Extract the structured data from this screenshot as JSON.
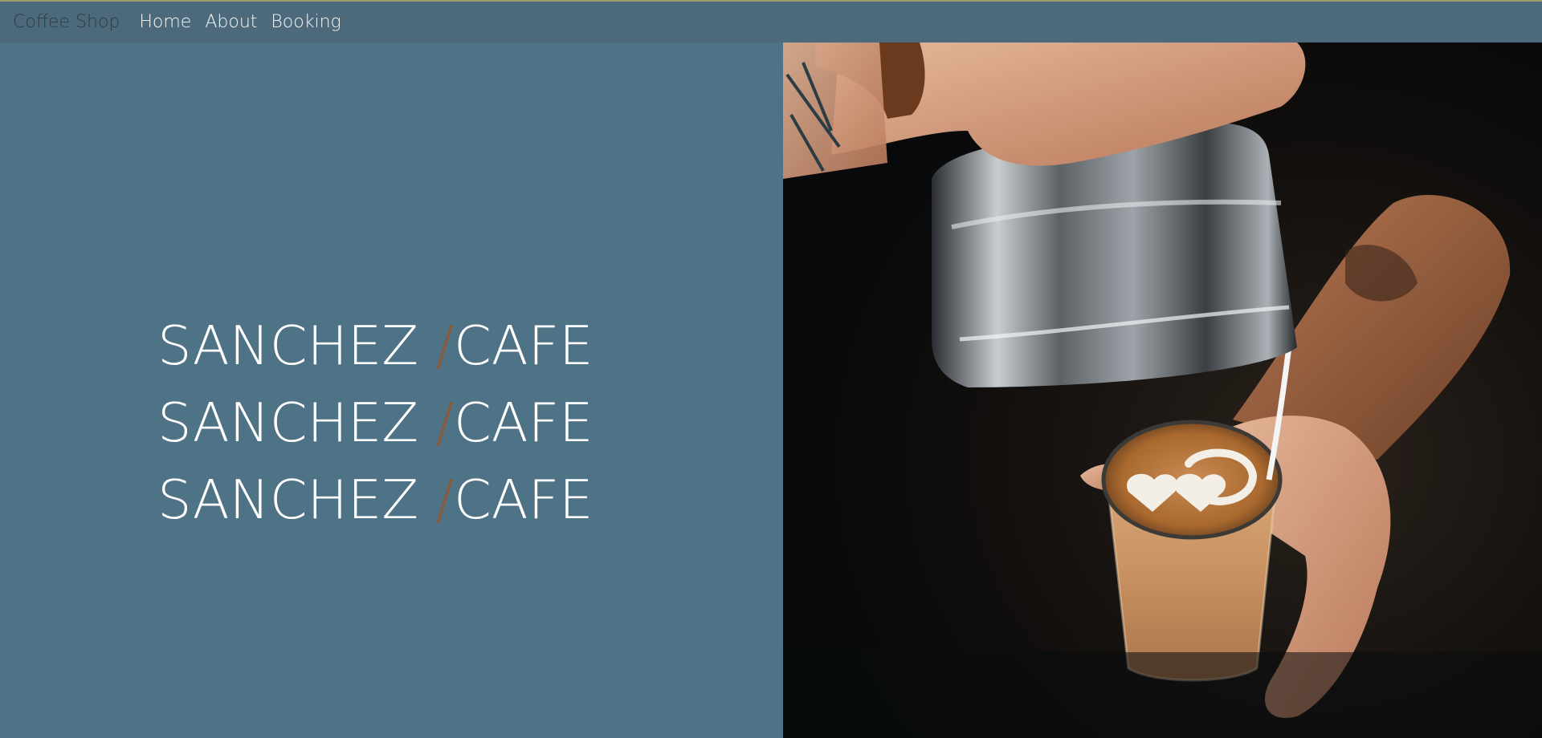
{
  "navbar": {
    "brand": "Coffee Shop",
    "links": [
      {
        "label": "Home"
      },
      {
        "label": "About"
      },
      {
        "label": "Booking"
      }
    ]
  },
  "hero": {
    "lines": [
      {
        "first": "SANCHEZ ",
        "slash": "/",
        "second": "CAFE"
      },
      {
        "first": "SANCHEZ ",
        "slash": "/",
        "second": "CAFE"
      },
      {
        "first": "SANCHEZ ",
        "slash": "/",
        "second": "CAFE"
      }
    ],
    "photo_subject": "barista-pouring-latte-art"
  },
  "colors": {
    "navbar_bg": "#4c6a7b",
    "hero_bg": "#4f7386",
    "slash_accent": "#8a5a3a",
    "brand_text": "#2c3c45",
    "nav_text": "#f4f7f8"
  }
}
